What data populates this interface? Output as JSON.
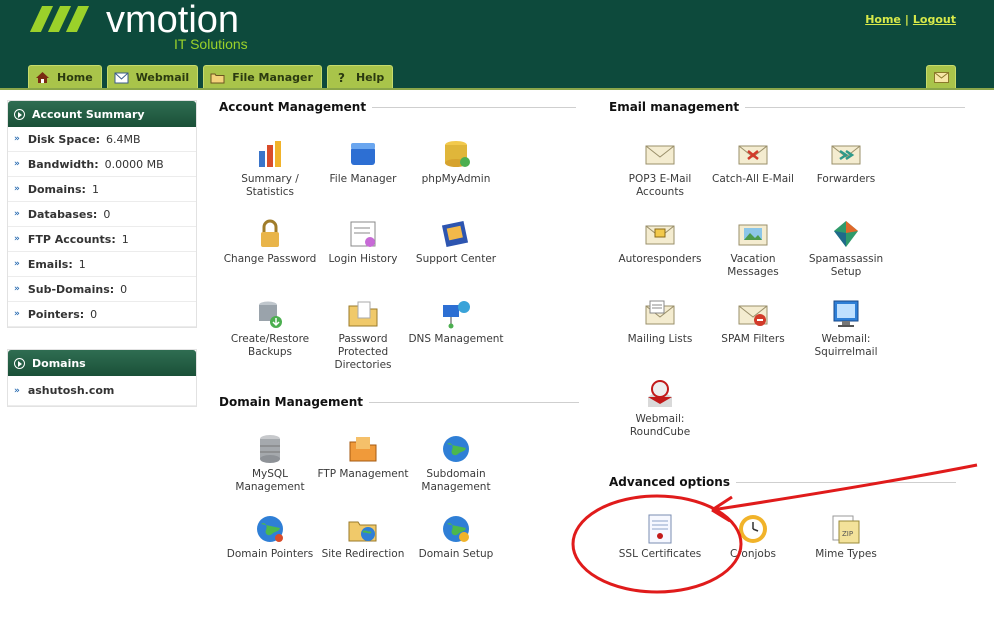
{
  "brand": {
    "name": "vmotion",
    "tagline": "IT Solutions"
  },
  "top_links": {
    "home": "Home",
    "separator": "|",
    "logout": "Logout"
  },
  "tabs": [
    {
      "label": "Home",
      "icon": "home-icon"
    },
    {
      "label": "Webmail",
      "icon": "webmail-icon"
    },
    {
      "label": "File Manager",
      "icon": "folder-icon"
    },
    {
      "label": "Help",
      "icon": "help-icon"
    }
  ],
  "account_summary": {
    "title": "Account Summary",
    "rows": [
      {
        "label": "Disk Space:",
        "value": "6.4MB"
      },
      {
        "label": "Bandwidth:",
        "value": "0.0000 MB"
      },
      {
        "label": "Domains:",
        "value": "1"
      },
      {
        "label": "Databases:",
        "value": "0"
      },
      {
        "label": "FTP Accounts:",
        "value": "1"
      },
      {
        "label": "Emails:",
        "value": "1"
      },
      {
        "label": "Sub-Domains:",
        "value": "0"
      },
      {
        "label": "Pointers:",
        "value": "0"
      }
    ]
  },
  "domains": {
    "title": "Domains",
    "items": [
      "ashutosh.com"
    ]
  },
  "account_management": {
    "title": "Account Management",
    "items": [
      {
        "label": "Summary / Statistics",
        "icon": "statistics-icon"
      },
      {
        "label": "File Manager",
        "icon": "file-manager-icon"
      },
      {
        "label": "phpMyAdmin",
        "icon": "database-icon"
      },
      {
        "label": "Change Password",
        "icon": "lock-icon"
      },
      {
        "label": "Login History",
        "icon": "login-history-icon"
      },
      {
        "label": "Support Center",
        "icon": "support-icon"
      },
      {
        "label": "Create/Restore Backups",
        "icon": "backup-icon"
      },
      {
        "label": "Password Protected Directories",
        "icon": "protected-folder-icon"
      },
      {
        "label": "DNS Management",
        "icon": "dns-icon"
      }
    ]
  },
  "domain_management": {
    "title": "Domain Management",
    "items": [
      {
        "label": "MySQL Management",
        "icon": "mysql-icon"
      },
      {
        "label": "FTP Management",
        "icon": "ftp-icon"
      },
      {
        "label": "Subdomain Management",
        "icon": "globe-icon"
      },
      {
        "label": "Domain Pointers",
        "icon": "globe-pointer-icon"
      },
      {
        "label": "Site Redirection",
        "icon": "redirect-icon"
      },
      {
        "label": "Domain Setup",
        "icon": "domain-setup-icon"
      }
    ]
  },
  "email_management": {
    "title": "Email management",
    "items": [
      {
        "label": "POP3 E-Mail Accounts",
        "icon": "envelope-icon"
      },
      {
        "label": "Catch-All E-Mail",
        "icon": "catch-all-envelope-icon"
      },
      {
        "label": "Forwarders",
        "icon": "forward-envelope-icon"
      },
      {
        "label": "Autoresponders",
        "icon": "autoresponder-icon"
      },
      {
        "label": "Vacation Messages",
        "icon": "vacation-icon"
      },
      {
        "label": "Spamassassin Setup",
        "icon": "spamassassin-icon"
      },
      {
        "label": "Mailing Lists",
        "icon": "mailing-list-icon"
      },
      {
        "label": "SPAM Filters",
        "icon": "spam-filter-icon"
      },
      {
        "label": "Webmail: Squirrelmail",
        "icon": "squirrelmail-icon"
      },
      {
        "label": "Webmail: RoundCube",
        "icon": "roundcube-icon"
      }
    ]
  },
  "advanced_options": {
    "title": "Advanced options",
    "items": [
      {
        "label": "SSL Certificates",
        "icon": "certificate-icon"
      },
      {
        "label": "Cronjobs",
        "icon": "clock-icon"
      },
      {
        "label": "Mime Types",
        "icon": "mime-types-icon"
      }
    ]
  },
  "colors": {
    "header": "#0d4a3c",
    "accent": "#9bd12a",
    "tab": "#a9c44a",
    "annotation": "#e01b1b"
  }
}
